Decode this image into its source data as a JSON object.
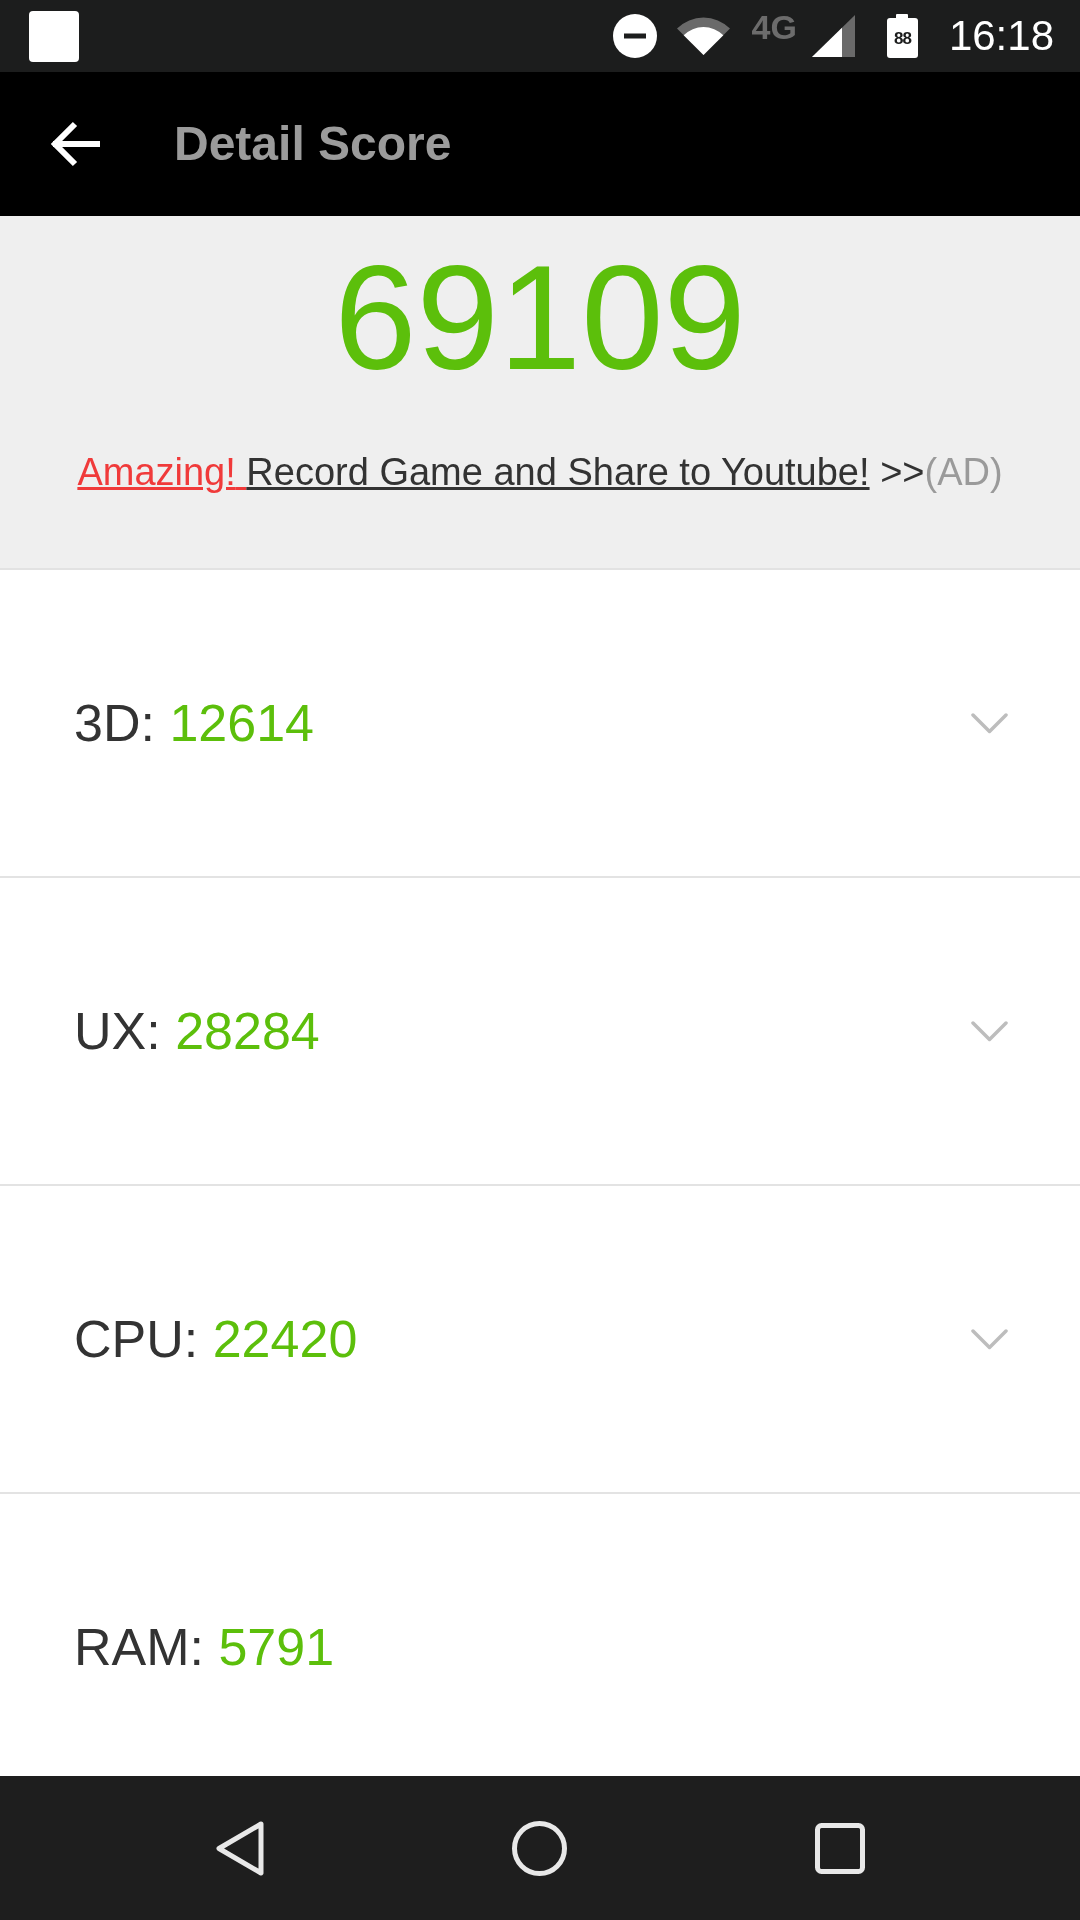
{
  "status_bar": {
    "network": "4G",
    "battery": "88",
    "time": "16:18"
  },
  "toolbar": {
    "title": "Detail Score"
  },
  "summary": {
    "score": "69109",
    "promo": {
      "highlight": "Amazing!",
      "text": "Record Game and Share to Youtube!",
      "arrow": ">>",
      "tag": "(AD)"
    }
  },
  "categories": [
    {
      "label": "3D:",
      "score": "12614",
      "kind": "expandable"
    },
    {
      "label": "UX:",
      "score": "28284",
      "kind": "expandable"
    },
    {
      "label": "CPU:",
      "score": "22420",
      "kind": "expandable"
    },
    {
      "label": "RAM:",
      "score": "5791",
      "kind": "plain"
    }
  ]
}
